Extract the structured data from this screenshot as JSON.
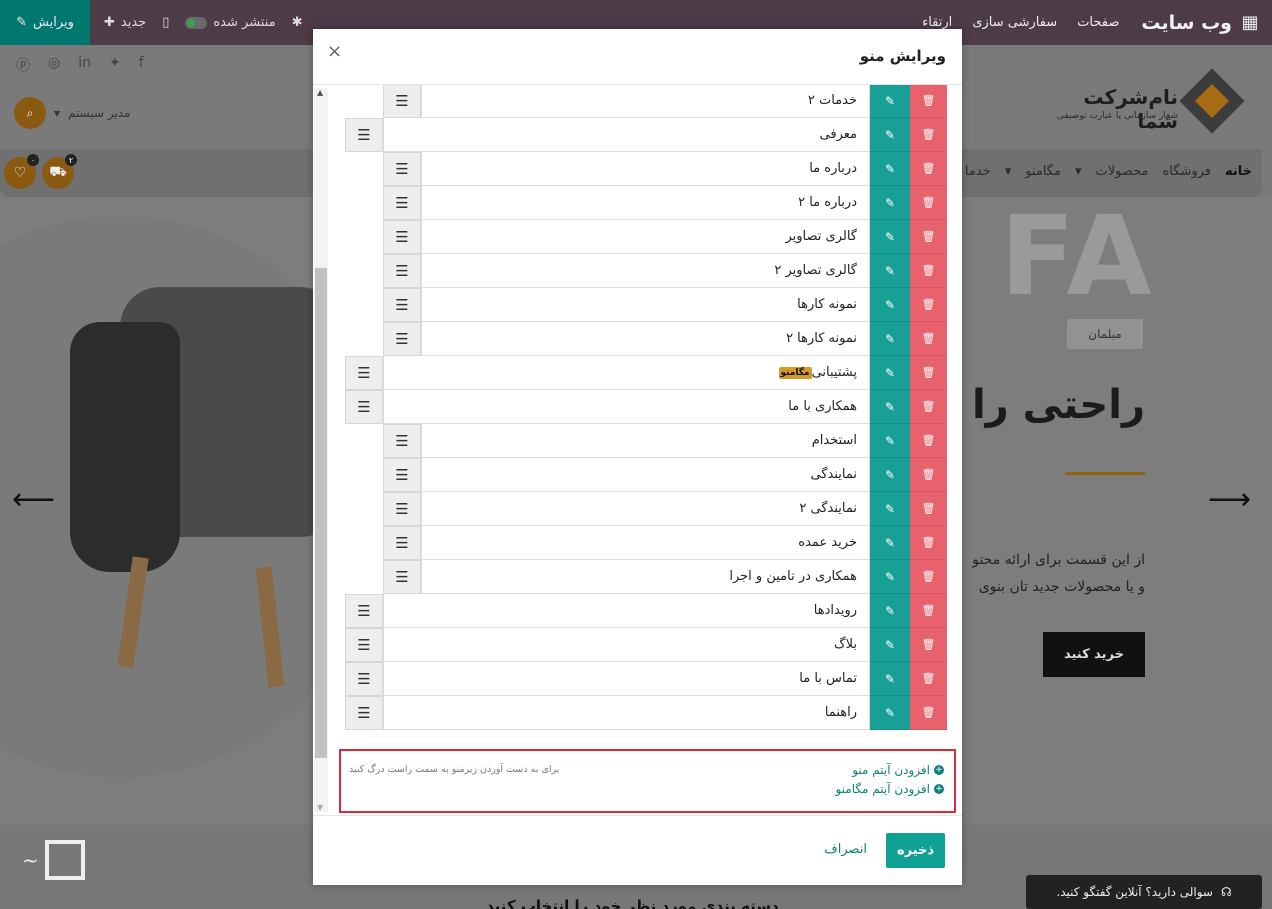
{
  "topbar": {
    "brand": "وب سایت",
    "nav": [
      "صفحات",
      "سفارشی سازی",
      "ارتقاء"
    ],
    "published": "منتشر شده",
    "new": "جدید",
    "edit": "ویرایش"
  },
  "site": {
    "logo_title": "نام‌شرکت شما",
    "logo_subtitle": "شعار سازمانی یا عبارت توصیفی",
    "admin": "مدیر سیستم",
    "nav_links": [
      "خانه",
      "فروشگاه",
      "محصولات",
      "مگامنو",
      "خدما"
    ],
    "cart_count": "۲",
    "wishlist_count": "۰",
    "big_letters": "FA",
    "tag": "مبلمان",
    "headline": "راحتی را تـ",
    "body_line1": "از این قسمت برای ارائه محتو",
    "body_line2": "و یا محصولات جدید تان بنوی",
    "buy": "خرید کنید",
    "bottom_text": "دسته بندی مورد نظر خود را انتخاب کنید",
    "chat": "سوالی دارید؟ آنلاین گفتگو کنید."
  },
  "modal": {
    "title": "ویرایش منو",
    "items": [
      {
        "label": "خدمات ۲",
        "level": 1
      },
      {
        "label": "معرفی",
        "level": 0
      },
      {
        "label": "درباره ما",
        "level": 1
      },
      {
        "label": "درباره ما ۲",
        "level": 1
      },
      {
        "label": "گالری تصاویر",
        "level": 1
      },
      {
        "label": "گالری تصاویر ۲",
        "level": 1
      },
      {
        "label": "نمونه کارها",
        "level": 1
      },
      {
        "label": "نمونه کارها ۲",
        "level": 1
      },
      {
        "label": "پشتیبانی",
        "level": 0,
        "badge": "مگامنو"
      },
      {
        "label": "همکاری با ما",
        "level": 0
      },
      {
        "label": "استخدام",
        "level": 1
      },
      {
        "label": "نمایندگی",
        "level": 1
      },
      {
        "label": "نمایندگی ۲",
        "level": 1
      },
      {
        "label": "خرید عمده",
        "level": 1
      },
      {
        "label": "همکاری در تامین و اجرا",
        "level": 1
      },
      {
        "label": "رویدادها",
        "level": 0
      },
      {
        "label": "بلاگ",
        "level": 0
      },
      {
        "label": "تماس با ما",
        "level": 0
      },
      {
        "label": "راهنما",
        "level": 0
      }
    ],
    "add_menu_item": "افزودن آیتم منو",
    "add_mega_item": "افزودن آیتم مگامنو",
    "drag_hint": "برای به دست آوردن زیرمنو به سمت راست درگ کنید",
    "save": "ذخیره",
    "cancel": "انصراف"
  },
  "colors": {
    "delete": "#e8626e",
    "edit": "#18a097",
    "highlight_border": "#d92a3a"
  }
}
